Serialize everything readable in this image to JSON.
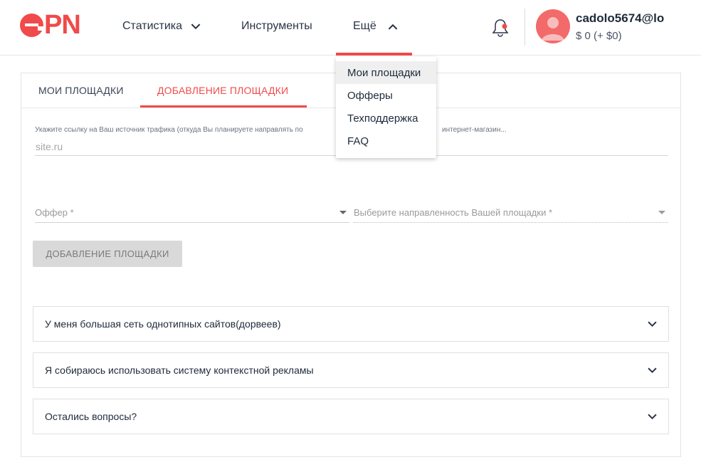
{
  "brand": {
    "logo_text": "PN",
    "accent_color": "#f04a4a"
  },
  "nav": {
    "items": [
      {
        "label": "Статистика",
        "icon": "chevron-down-icon"
      },
      {
        "label": "Инструменты"
      },
      {
        "label": "Ещё",
        "icon": "chevron-up-icon"
      }
    ],
    "notification_icon": "bell-icon"
  },
  "user": {
    "name": "cadolo5674@lo",
    "balance": "$ 0 (+ $0)",
    "avatar_icon": "user-avatar-icon"
  },
  "dropdown": {
    "items": [
      {
        "label": "Мои площадки",
        "active": true
      },
      {
        "label": "Офферы"
      },
      {
        "label": "Техподдержка"
      },
      {
        "label": "FAQ"
      }
    ]
  },
  "tabs": [
    {
      "label": "МОИ ПЛОЩАДКИ"
    },
    {
      "label": "ДОБАВЛЕНИЕ ПЛОЩАДКИ",
      "active": true
    }
  ],
  "form": {
    "source_label_start": "Укажите ссылку на Ваш источник трафика (откуда Вы планируете направлять по",
    "source_label_end": "интернет-магазин...",
    "source_placeholder": "site.ru",
    "offer_placeholder": "Оффер *",
    "direction_placeholder": "Выберите направленность Вашей площадки *",
    "submit_label": "ДОБАВЛЕНИЕ ПЛОЩАДКИ"
  },
  "accordion": [
    {
      "title": "У меня большая сеть однотипных сайтов(дорвеев)"
    },
    {
      "title": "Я собираюсь использовать систему контекстной рекламы"
    },
    {
      "title": "Остались вопросы?"
    }
  ]
}
